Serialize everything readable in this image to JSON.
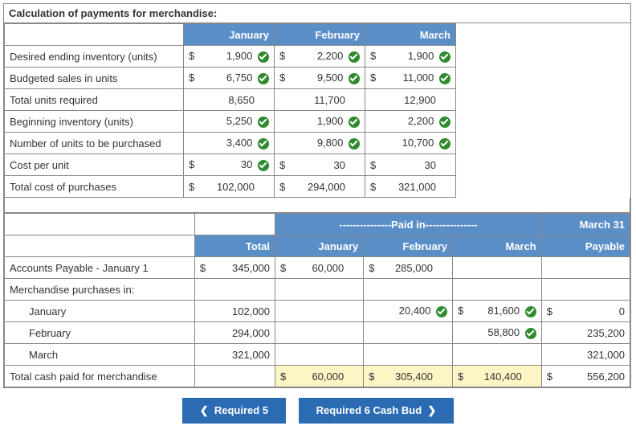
{
  "title": "Calculation of payments for merchandise:",
  "months": {
    "jan": "January",
    "feb": "February",
    "mar": "March"
  },
  "rows1": {
    "dei": {
      "label": "Desired ending inventory (units)",
      "jan": "1,900",
      "feb": "2,200",
      "mar": "1,900",
      "dollar": true,
      "check": true
    },
    "bsu": {
      "label": "Budgeted sales in units",
      "jan": "6,750",
      "feb": "9,500",
      "mar": "11,000",
      "dollar": true,
      "check": true
    },
    "tur": {
      "label": "Total units required",
      "jan": "8,650",
      "feb": "11,700",
      "mar": "12,900"
    },
    "bi": {
      "label": "Beginning inventory (units)",
      "jan": "5,250",
      "feb": "1,900",
      "mar": "2,200",
      "check": true
    },
    "nup": {
      "label": "Number of units to be purchased",
      "jan": "3,400",
      "feb": "9,800",
      "mar": "10,700",
      "check": true
    },
    "cpu": {
      "label": "Cost per unit",
      "jan": "30",
      "feb": "30",
      "mar": "30",
      "dollar": true,
      "janCheck": true
    },
    "tcp": {
      "label": "Total cost of purchases",
      "jan": "102,000",
      "feb": "294,000",
      "mar": "321,000",
      "dollar": true
    }
  },
  "table2": {
    "paidIn": "---------------Paid in---------------",
    "march31": "March 31",
    "totalHdr": "Total",
    "payableHdr": "Payable",
    "ap": {
      "label": "Accounts Payable - January 1",
      "total": "345,000",
      "jan": "60,000",
      "feb": "285,000"
    },
    "mpi": "Merchandise purchases in:",
    "pJan": {
      "label": "January",
      "total": "102,000",
      "feb": "20,400",
      "mar": "81,600",
      "pay": "0"
    },
    "pFeb": {
      "label": "February",
      "total": "294,000",
      "mar": "58,800",
      "pay": "235,200"
    },
    "pMar": {
      "label": "March",
      "total": "321,000",
      "pay": "321,000"
    },
    "tcpm": {
      "label": "Total cash paid for merchandise",
      "jan": "60,000",
      "feb": "305,400",
      "mar": "140,400",
      "pay": "556,200"
    }
  },
  "nav": {
    "prev": "Required 5",
    "next": "Required 6 Cash Bud"
  }
}
